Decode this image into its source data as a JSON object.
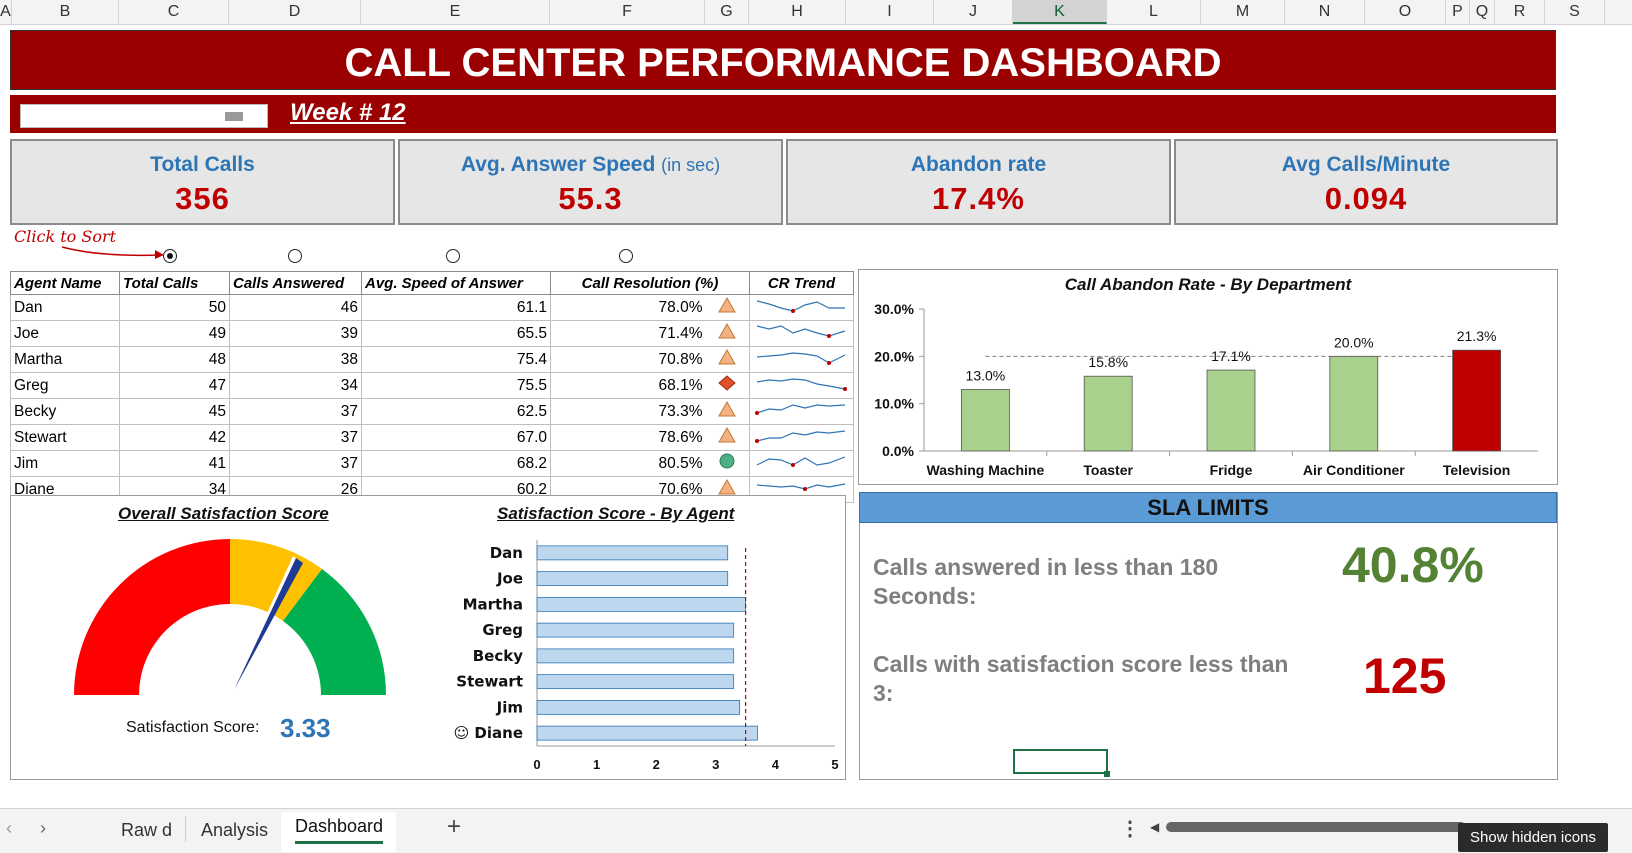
{
  "columns": [
    "A",
    "B",
    "C",
    "D",
    "E",
    "F",
    "G",
    "H",
    "I",
    "J",
    "K",
    "L",
    "M",
    "N",
    "O",
    "P",
    "Q",
    "R",
    "S"
  ],
  "title": "CALL CENTER PERFORMANCE DASHBOARD",
  "week_label": "Week # 12",
  "kpis": [
    {
      "label": "Total Calls",
      "sub": "",
      "value": "356"
    },
    {
      "label": "Avg. Answer Speed",
      "sub": "(in sec)",
      "value": "55.3"
    },
    {
      "label": "Abandon rate",
      "sub": "",
      "value": "17.4%"
    },
    {
      "label": "Avg Calls/Minute",
      "sub": "",
      "value": "0.094"
    }
  ],
  "sort_hint": "Click to Sort",
  "table": {
    "headers": [
      "Agent Name",
      "Total Calls",
      "Calls Answered",
      "Avg. Speed of Answer",
      "Call Resolution (%)",
      "CR Trend"
    ],
    "rows": [
      {
        "name": "Dan",
        "total": "50",
        "answered": "46",
        "speed": "61.1",
        "resolution": "78.0%",
        "icon": "warning-triangle"
      },
      {
        "name": "Joe",
        "total": "49",
        "answered": "39",
        "speed": "65.5",
        "resolution": "71.4%",
        "icon": "warning-triangle"
      },
      {
        "name": "Martha",
        "total": "48",
        "answered": "38",
        "speed": "75.4",
        "resolution": "70.8%",
        "icon": "warning-triangle"
      },
      {
        "name": "Greg",
        "total": "47",
        "answered": "34",
        "speed": "75.5",
        "resolution": "68.1%",
        "icon": "red-diamond"
      },
      {
        "name": "Becky",
        "total": "45",
        "answered": "37",
        "speed": "62.5",
        "resolution": "73.3%",
        "icon": "warning-triangle"
      },
      {
        "name": "Stewart",
        "total": "42",
        "answered": "37",
        "speed": "67.0",
        "resolution": "78.6%",
        "icon": "warning-triangle"
      },
      {
        "name": "Jim",
        "total": "41",
        "answered": "37",
        "speed": "68.2",
        "resolution": "80.5%",
        "icon": "green-circle"
      },
      {
        "name": "Diane",
        "total": "34",
        "answered": "26",
        "speed": "60.2",
        "resolution": "70.6%",
        "icon": "warning-triangle"
      }
    ]
  },
  "abandon_chart": {
    "type": "bar",
    "title": "Call Abandon Rate - By Department",
    "categories": [
      "Washing Machine",
      "Toaster",
      "Fridge",
      "Air Conditioner",
      "Television"
    ],
    "values": [
      13.0,
      15.8,
      17.1,
      20.0,
      21.3
    ],
    "value_labels": [
      "13.0%",
      "15.8%",
      "17.1%",
      "20.0%",
      "21.3%"
    ],
    "ytick_labels": [
      "30.0%",
      "20.0%",
      "10.0%",
      "0.0%"
    ],
    "ylim": [
      0,
      30
    ],
    "target_line": 20.0,
    "bar_color": "#a9d18e",
    "highlight_color": "#c00000",
    "highlight_index": 4
  },
  "gauge": {
    "title": "Overall Satisfaction Score",
    "label": "Satisfaction Score:",
    "value": "3.33",
    "score": 3.33,
    "max": 5,
    "colors": [
      "#ff0000",
      "#ffc000",
      "#00b050"
    ]
  },
  "agent_chart": {
    "type": "bar",
    "title": "Satisfaction Score - By Agent",
    "categories": [
      "Dan",
      "Joe",
      "Martha",
      "Greg",
      "Becky",
      "Stewart",
      "Jim",
      "Diane"
    ],
    "values": [
      3.2,
      3.2,
      3.5,
      3.3,
      3.3,
      3.3,
      3.4,
      3.7
    ],
    "xticks": [
      "0",
      "1",
      "2",
      "3",
      "4",
      "5"
    ],
    "xlim": [
      0,
      5
    ],
    "target_line": 3.5,
    "top_agent_marker": "☺"
  },
  "sla": {
    "header": "SLA LIMITS",
    "items": [
      {
        "text": "Calls answered in less than 180 Seconds:",
        "value": "40.8%",
        "color": "#548235"
      },
      {
        "text": "Calls with satisfaction score less than 3:",
        "value": "125",
        "color": "#c00000"
      }
    ]
  },
  "sheet_tabs": [
    "Raw d",
    "Analysis",
    "Dashboard"
  ],
  "active_tab": "Dashboard",
  "tooltip": "Show hidden icons"
}
